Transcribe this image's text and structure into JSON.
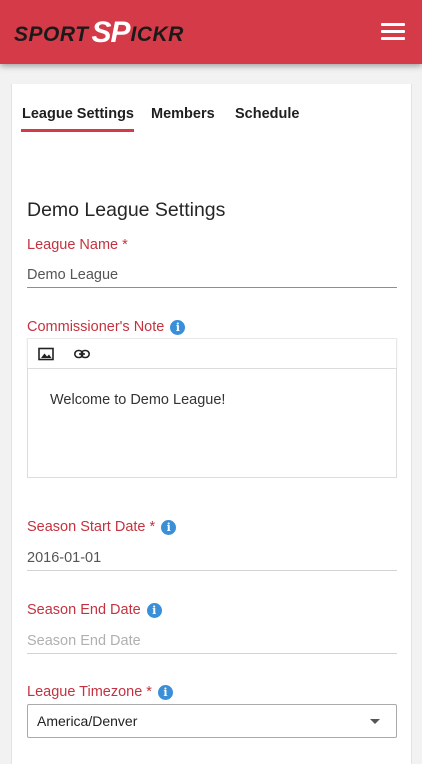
{
  "header": {
    "logo": {
      "part1": "SPORT",
      "part2": "SP",
      "part3": "ICKR"
    },
    "menu_icon": "hamburger-menu-icon",
    "background_color": "#d43a47"
  },
  "tabs": [
    {
      "label": "League Settings",
      "active": true
    },
    {
      "label": "Members",
      "active": false
    },
    {
      "label": "Schedule",
      "active": false
    }
  ],
  "page_title": "Demo League Settings",
  "fields": {
    "league_name": {
      "label": "League Name *",
      "value": "Demo League"
    },
    "commissioner_note": {
      "label": "Commissioner's Note",
      "info_icon": "info-icon",
      "toolbar": [
        "image-icon",
        "link-icon"
      ],
      "content": "Welcome to Demo League!"
    },
    "season_start": {
      "label": "Season Start Date *",
      "value": "2016-01-01",
      "info_icon": "info-icon"
    },
    "season_end": {
      "label": "Season End Date",
      "placeholder": "Season End Date",
      "info_icon": "info-icon"
    },
    "timezone": {
      "label": "League Timezone *",
      "value": "America/Denver",
      "info_icon": "info-icon"
    }
  },
  "colors": {
    "accent": "#d43a47",
    "label": "#c4323f",
    "info": "#3b8fd9"
  }
}
